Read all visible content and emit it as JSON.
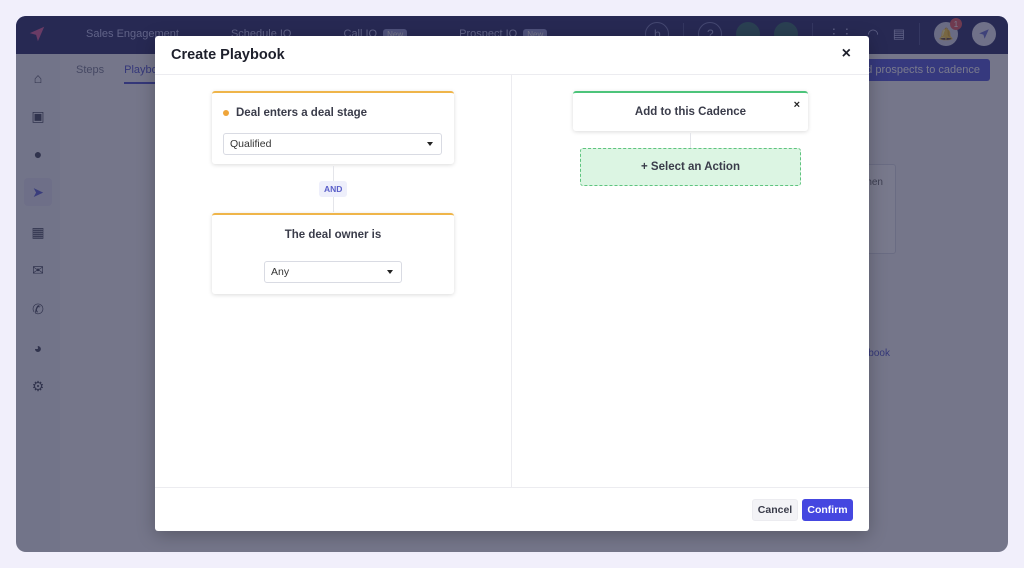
{
  "app": {
    "topnav": [
      {
        "label": "Sales Engagement",
        "badge": null
      },
      {
        "label": "Schedule IQ",
        "badge": null
      },
      {
        "label": "Call IQ",
        "badge": "New"
      },
      {
        "label": "Prospect IQ",
        "badge": "New"
      }
    ],
    "notification_count": "1",
    "profile_initial": "b",
    "subtabs": [
      "Steps",
      "Playbooks"
    ],
    "background_button": "Add prospects to cadence",
    "background_card_text": "When",
    "background_link": "Create Playbook",
    "sidebar_icons": [
      "home-icon",
      "inbox-icon",
      "user-icon",
      "send-icon",
      "clipboard-check-icon",
      "mail-icon",
      "phone-icon",
      "pie-chart-icon",
      "gear-icon"
    ],
    "active_sidebar": "send-icon"
  },
  "modal": {
    "title": "Create Playbook",
    "close_label": "×",
    "trigger": {
      "title": "Deal enters a deal stage",
      "selected": "Qualified"
    },
    "connector_label": "AND",
    "condition": {
      "title": "The deal owner is",
      "selected": "Any"
    },
    "action_card": {
      "title": "Add to this Cadence",
      "close_label": "×"
    },
    "select_action_label": "+ Select an Action",
    "footer": {
      "cancel_label": "Cancel",
      "confirm_label": "Confirm"
    }
  },
  "colors": {
    "primary": "#4547e0",
    "trigger_accent": "#efb54a",
    "action_accent": "#4cc47a",
    "action_bg": "#dcf5e3",
    "topbar": "#12165a"
  }
}
